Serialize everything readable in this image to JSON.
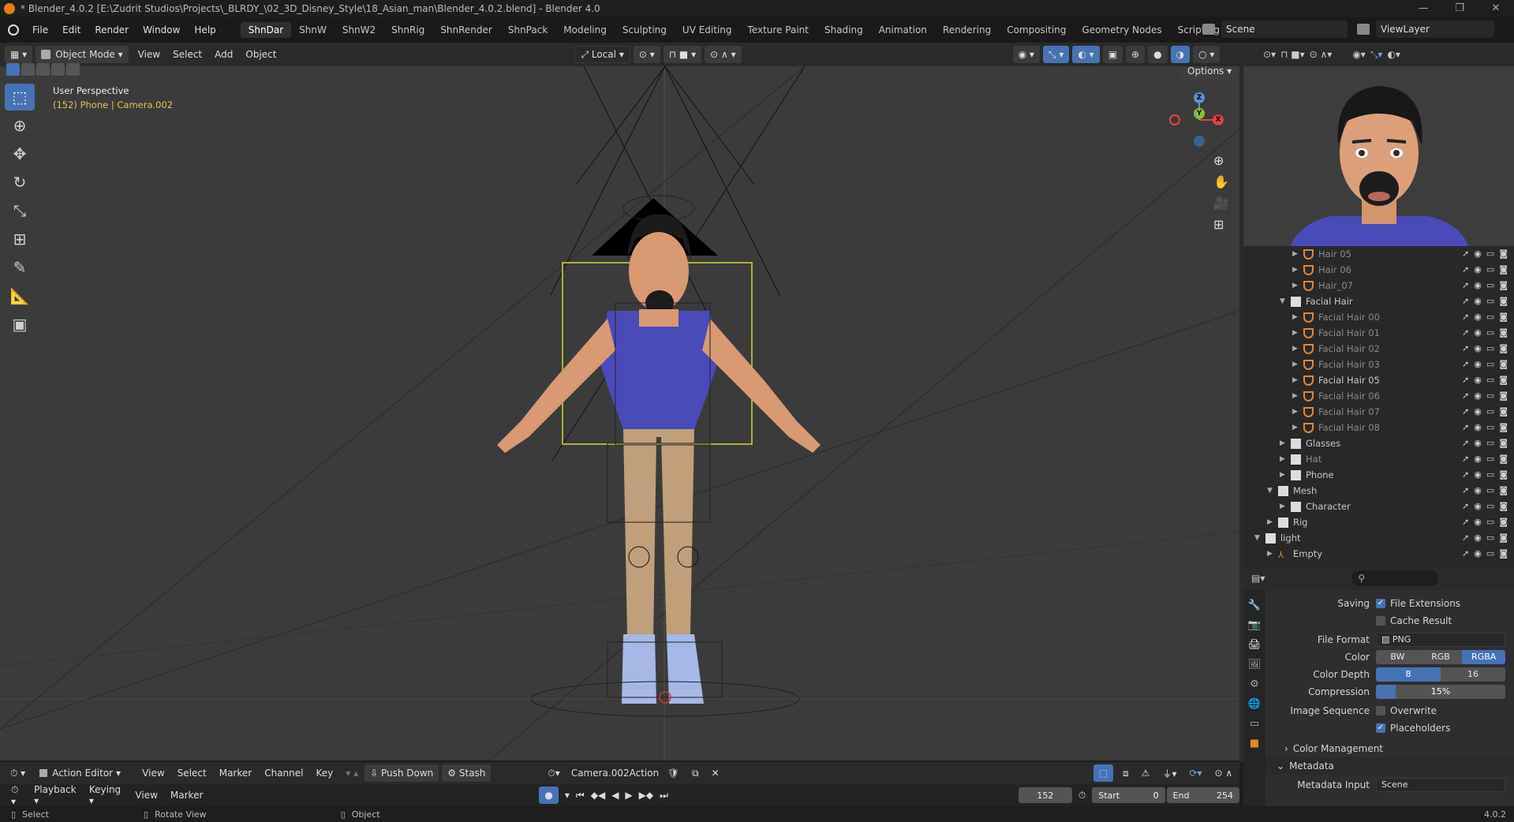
{
  "window": {
    "title": "* Blender_4.0.2 [E:\\Zudrit Studios\\Projects\\_BLRDY_\\02_3D_Disney_Style\\18_Asian_man\\Blender_4.0.2.blend] - Blender 4.0",
    "minimize": "—",
    "maximize": "❐",
    "close": "✕"
  },
  "menus": [
    "File",
    "Edit",
    "Render",
    "Window",
    "Help"
  ],
  "workspaces": [
    "ShnDar",
    "ShnW",
    "ShnW2",
    "ShnRig",
    "ShnRender",
    "ShnPack",
    "Modeling",
    "Sculpting",
    "UV Editing",
    "Texture Paint",
    "Shading",
    "Animation",
    "Rendering",
    "Compositing",
    "Geometry Nodes",
    "Scripting"
  ],
  "active_workspace": "ShnDar",
  "add_workspace": "+",
  "scene": {
    "label": "Scene",
    "viewlayer": "ViewLayer"
  },
  "header3d": {
    "mode": "Object Mode",
    "menus": [
      "View",
      "Select",
      "Add",
      "Object"
    ],
    "orientation": "Local",
    "options": "Options"
  },
  "viewport": {
    "perspective": "User Perspective",
    "info": "(152) Phone | Camera.002",
    "gizmo": {
      "z": "Z",
      "y": "Y",
      "x": "X"
    }
  },
  "outliner": {
    "rows": [
      {
        "label": "Hair 05",
        "indent": 3,
        "type": "hair",
        "dim": true
      },
      {
        "label": "Hair 06",
        "indent": 3,
        "type": "hair",
        "dim": true
      },
      {
        "label": "Hair_07",
        "indent": 3,
        "type": "hair",
        "dim": true
      },
      {
        "label": "Facial Hair",
        "indent": 2,
        "type": "collection",
        "dim": false,
        "expanded": true
      },
      {
        "label": "Facial Hair 00",
        "indent": 3,
        "type": "hair",
        "dim": true
      },
      {
        "label": "Facial Hair 01",
        "indent": 3,
        "type": "hair",
        "dim": true
      },
      {
        "label": "Facial Hair 02",
        "indent": 3,
        "type": "hair",
        "dim": true
      },
      {
        "label": "Facial Hair 03",
        "indent": 3,
        "type": "hair",
        "dim": true
      },
      {
        "label": "Facial Hair 05",
        "indent": 3,
        "type": "hair",
        "dim": false
      },
      {
        "label": "Facial Hair 06",
        "indent": 3,
        "type": "hair",
        "dim": true
      },
      {
        "label": "Facial Hair 07",
        "indent": 3,
        "type": "hair",
        "dim": true
      },
      {
        "label": "Facial Hair 08",
        "indent": 3,
        "type": "hair",
        "dim": true
      },
      {
        "label": "Glasses",
        "indent": 2,
        "type": "collection",
        "dim": false
      },
      {
        "label": "Hat",
        "indent": 2,
        "type": "collection",
        "dim": true
      },
      {
        "label": "Phone",
        "indent": 2,
        "type": "collection",
        "dim": false
      },
      {
        "label": "Mesh",
        "indent": 1,
        "type": "collection",
        "dim": false,
        "expanded": true
      },
      {
        "label": "Character",
        "indent": 2,
        "type": "collection",
        "dim": false
      },
      {
        "label": "Rig",
        "indent": 1,
        "type": "collection",
        "dim": false
      },
      {
        "label": "light",
        "indent": 0,
        "type": "collection",
        "dim": false,
        "expanded": true
      },
      {
        "label": "Empty",
        "indent": 1,
        "type": "empty",
        "dim": false
      }
    ]
  },
  "properties": {
    "saving_label": "Saving",
    "file_extensions": "File Extensions",
    "cache_result": "Cache Result",
    "file_format_label": "File Format",
    "file_format": "PNG",
    "color_label": "Color",
    "color_options": [
      "BW",
      "RGB",
      "RGBA"
    ],
    "color_selected": "RGBA",
    "color_depth_label": "Color Depth",
    "color_depth": [
      "8",
      "16"
    ],
    "compression_label": "Compression",
    "compression": "15%",
    "compression_value": 0.15,
    "image_sequence_label": "Image Sequence",
    "overwrite": "Overwrite",
    "placeholders": "Placeholders",
    "color_management": "Color Management",
    "metadata": "Metadata",
    "metadata_input_label": "Metadata Input",
    "metadata_input": "Scene"
  },
  "action_editor": {
    "mode": "Action Editor",
    "menus": [
      "View",
      "Select",
      "Marker",
      "Channel",
      "Key"
    ],
    "push_down": "Push Down",
    "stash": "Stash",
    "action": "Camera.002Action"
  },
  "timeline": {
    "menus": [
      "Playback",
      "Keying",
      "View",
      "Marker"
    ],
    "current_frame": "152",
    "start_label": "Start",
    "start": "0",
    "end_label": "End",
    "end": "254"
  },
  "status": {
    "select": "Select",
    "rotate": "Rotate View",
    "object": "Object",
    "version": "4.0.2"
  }
}
